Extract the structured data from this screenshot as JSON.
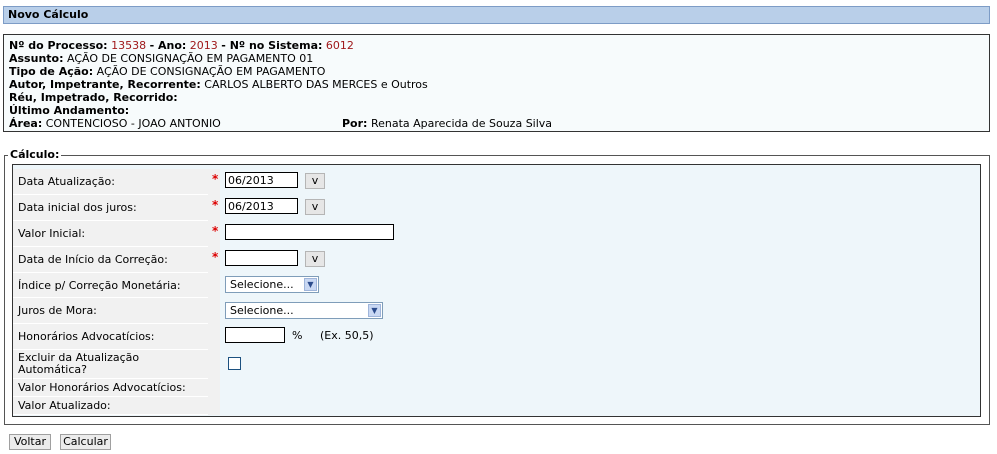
{
  "title": "Novo Cálculo",
  "info": {
    "processo_label": "Nº do Processo:",
    "processo_value": "13538",
    "ano_label": "Ano:",
    "ano_value": "2013",
    "sistema_label": "Nº no Sistema:",
    "sistema_value": "6012",
    "assunto_label": "Assunto:",
    "assunto_value": "AÇÃO DE CONSIGNAÇÃO EM PAGAMENTO 01",
    "tipo_label": "Tipo de Ação:",
    "tipo_value": "AÇÃO DE CONSIGNAÇÃO EM PAGAMENTO",
    "autor_label": "Autor, Impetrante, Recorrente:",
    "autor_value": "CARLOS ALBERTO DAS MERCES e Outros",
    "reu_label": "Réu, Impetrado, Recorrido:",
    "andamento_label": "Último Andamento:",
    "area_label": "Área:",
    "area_value": "CONTENCIOSO - JOAO ANTONIO",
    "por_label": "Por:",
    "por_value": "Renata Aparecida de Souza Silva"
  },
  "calculo": {
    "legend": "Cálculo:",
    "required_mark": "*",
    "labels": {
      "data_atualizacao": "Data Atualização:",
      "data_inicial_juros": "Data inicial dos juros:",
      "valor_inicial": "Valor Inicial:",
      "data_inicio_correcao": "Data de Início da Correção:",
      "indice": "Índice p/ Correção Monetária:",
      "juros_mora": "Juros de Mora:",
      "honorarios": "Honorários Advocatícios:",
      "excluir_line1": "Excluir da Atualização",
      "excluir_line2": "Automática?",
      "valor_honorarios": "Valor Honorários Advocatícios:",
      "valor_atualizado": "Valor Atualizado:"
    },
    "values": {
      "data_atualizacao": "06/2013",
      "data_inicial_juros": "06/2013",
      "valor_inicial": "",
      "data_inicio_correcao": "",
      "honorarios": ""
    },
    "calendar_button": "v",
    "indice_selected": "Selecione...",
    "juros_selected": "Selecione...",
    "percent_sign": "%",
    "honorarios_example": "(Ex. 50,5)",
    "excluir_checked": false
  },
  "buttons": {
    "voltar": "Voltar",
    "calcular": "Calcular"
  },
  "colors": {
    "title_bg": "#b9cfe9",
    "highlight_red": "#a0191b",
    "required_red": "#dd0000",
    "panel_bg": "#eef6fa"
  }
}
